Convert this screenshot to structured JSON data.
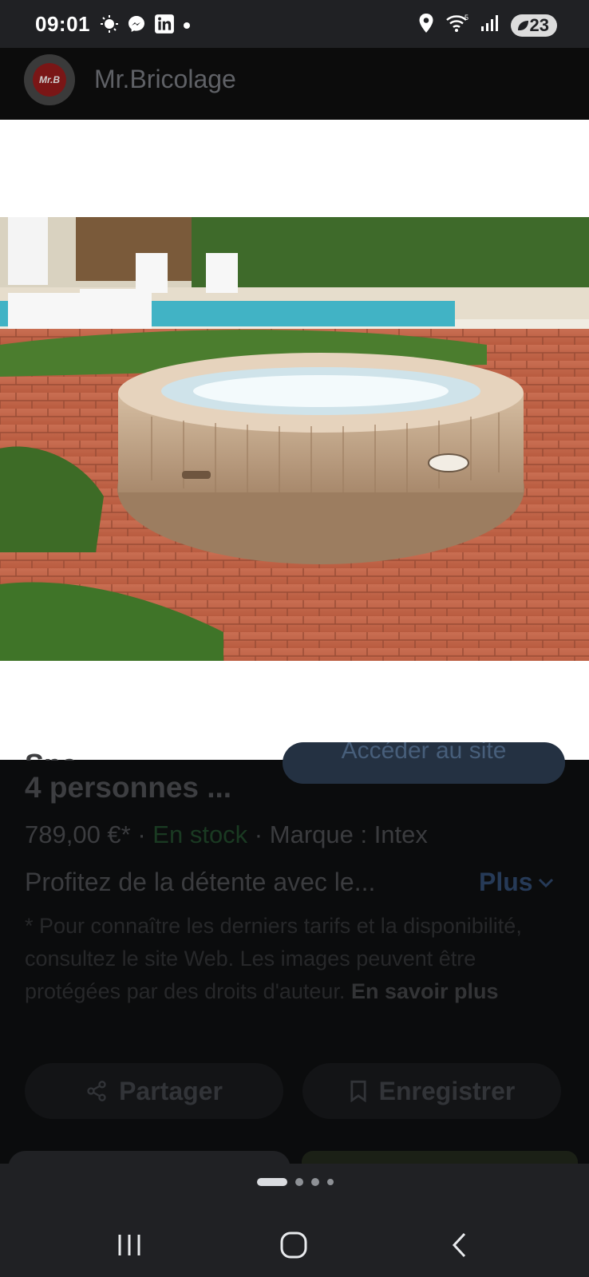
{
  "status_bar": {
    "time": "09:01",
    "battery": "23",
    "left_icons": [
      "weather-icon",
      "messenger-icon",
      "linkedin-icon",
      "dot-icon"
    ],
    "right_icons": [
      "location-icon",
      "wifi-icon",
      "signal-icon"
    ]
  },
  "header": {
    "logo_text": "Mr.B",
    "site_name": "Mr.Bricolage"
  },
  "product": {
    "visit_button": "Accéder au site",
    "title": "4 personnes ...",
    "price": "789,00 €*",
    "separator": " · ",
    "stock": "En stock",
    "brand": "Marque : Intex",
    "description": "Profitez de la détente avec le...",
    "more_label": "Plus",
    "disclaimer": "* Pour connaître les derniers tarifs et la disponibilité, consultez le site Web. Les images peuvent être protégées par des droits d'auteur.",
    "learn_more": "En savoir plus"
  },
  "actions": {
    "share_label": "Partager",
    "save_label": "Enregistrer"
  },
  "image_carousel": {
    "total_dots": 4,
    "active_index": 0
  },
  "colors": {
    "status_bar": "#202124",
    "background": "#0b0c0d",
    "stock_green": "#1a3a22",
    "link_blue": "#263a57"
  }
}
